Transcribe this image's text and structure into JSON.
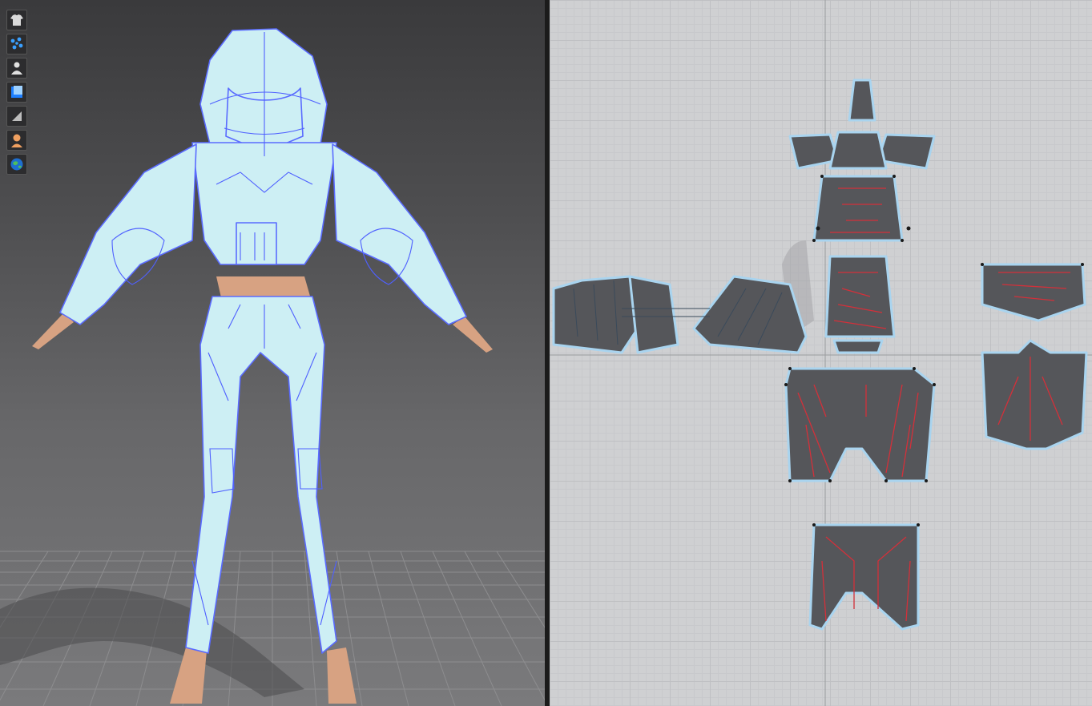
{
  "viewport_3d": {
    "toolbar": [
      {
        "name": "garment-display-icon"
      },
      {
        "name": "particle-points-icon"
      },
      {
        "name": "avatar-display-icon"
      },
      {
        "name": "texture-view-icon"
      },
      {
        "name": "render-mode-icon"
      },
      {
        "name": "avatar-skin-icon"
      },
      {
        "name": "environment-globe-icon"
      }
    ],
    "colors": {
      "garment_fill": "#cdeff4",
      "seam_lines": "#5a6bff",
      "skin": "#d7a282",
      "floor_grid": "#8a8a8c"
    }
  },
  "viewport_2d": {
    "colors": {
      "grid_bg": "#cfd0d2",
      "pattern_fill": "#55565a",
      "pattern_outline": "#a9d4ef",
      "seam_lines": "#d3303a",
      "points": "#1a1a1a"
    }
  }
}
